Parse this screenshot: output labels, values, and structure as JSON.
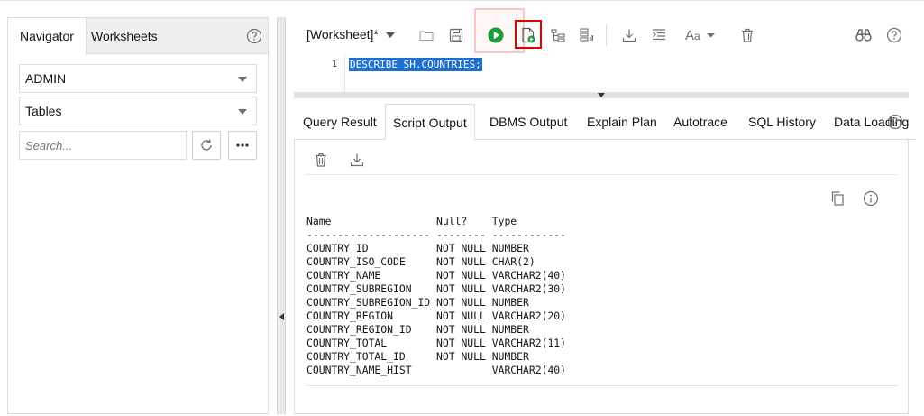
{
  "navigator": {
    "tabs": [
      {
        "label": "Navigator",
        "active": true
      },
      {
        "label": "Worksheets",
        "active": false
      }
    ],
    "schema_select": "ADMIN",
    "object_type_select": "Tables",
    "search_placeholder": "Search..."
  },
  "worksheet": {
    "name": "[Worksheet]*",
    "line_number": "1",
    "code": "DESCRIBE SH.COUNTRIES;"
  },
  "output_tabs": [
    {
      "label": "Query Result",
      "active": false
    },
    {
      "label": "Script Output",
      "active": true
    },
    {
      "label": "DBMS Output",
      "active": false
    },
    {
      "label": "Explain Plan",
      "active": false
    },
    {
      "label": "Autotrace",
      "active": false
    },
    {
      "label": "SQL History",
      "active": false
    },
    {
      "label": "Data Loading",
      "active": false
    }
  ],
  "script_output": {
    "header": "Name                 Null?    Type         ",
    "divider": "-------------------- -------- ------------ ",
    "rows": [
      "COUNTRY_ID           NOT NULL NUMBER       ",
      "COUNTRY_ISO_CODE     NOT NULL CHAR(2)      ",
      "COUNTRY_NAME         NOT NULL VARCHAR2(40) ",
      "COUNTRY_SUBREGION    NOT NULL VARCHAR2(30) ",
      "COUNTRY_SUBREGION_ID NOT NULL NUMBER       ",
      "COUNTRY_REGION       NOT NULL VARCHAR2(20) ",
      "COUNTRY_REGION_ID    NOT NULL NUMBER       ",
      "COUNTRY_TOTAL        NOT NULL VARCHAR2(11) ",
      "COUNTRY_TOTAL_ID     NOT NULL NUMBER       ",
      "COUNTRY_NAME_HIST             VARCHAR2(40) "
    ]
  },
  "colors": {
    "run_green": "#1f9d3a",
    "selection_blue": "#1f6fd1",
    "highlight_red": "#e00000",
    "icon_gray": "#6f6f6f"
  },
  "icons": {
    "toolbar": [
      "open-folder-icon",
      "save-icon",
      "run-statement-icon",
      "run-script-icon",
      "explain-plan-icon",
      "autotrace-icon",
      "download-icon",
      "format-icon",
      "font-case-icon",
      "clear-icon",
      "find-binoculars-icon",
      "help-icon"
    ],
    "output": [
      "clear-output-icon",
      "download-output-icon",
      "copy-icon",
      "info-icon"
    ]
  }
}
